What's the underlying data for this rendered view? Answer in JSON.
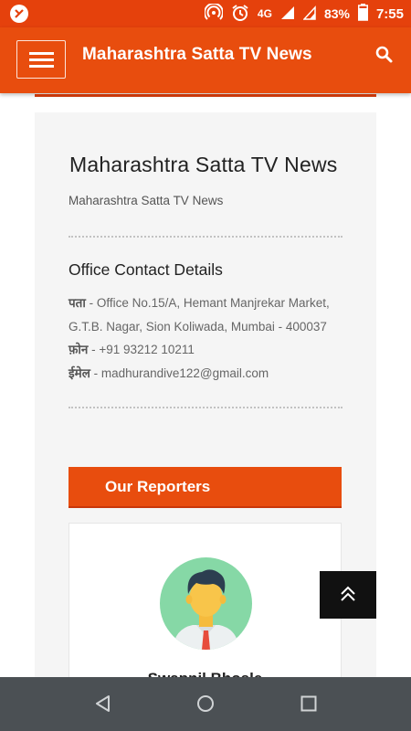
{
  "status_bar": {
    "network": "4G",
    "battery": "83%",
    "time": "7:55"
  },
  "header": {
    "site_title": "Maharashtra Satta TV News"
  },
  "widget": {
    "title": "Maharashtra Satta TV News",
    "subtitle": "Maharashtra Satta TV News"
  },
  "office": {
    "title": "Office Contact Details",
    "address_label": "पता",
    "address_value": " - Office No.15/A, Hemant Manjrekar Market, G.T.B. Nagar, Sion Koliwada, Mumbai - 400037",
    "phone_label": "फ़ोन",
    "phone_value": " - +91 93212 10211",
    "email_label": "ईमेल",
    "email_value": " - madhurandive122@gmail.com"
  },
  "reporters": {
    "section_title": "Our Reporters",
    "name": "Swapnil Bhosle"
  },
  "colors": {
    "brand": "#e84d0e",
    "status_bar": "#e5410c",
    "nav_bar": "#4b5054"
  }
}
